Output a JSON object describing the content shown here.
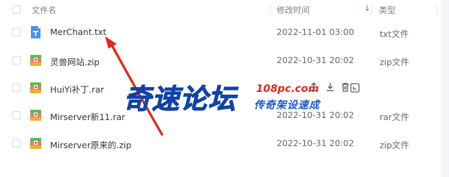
{
  "header": {
    "name_label": "文件名",
    "time_label": "修改时间",
    "sort_indicator": "↓",
    "type_label": "类型"
  },
  "files": [
    {
      "name": "MerChant.txt",
      "time": "2022-11-01 03:00",
      "type": "txt文件",
      "icon": "txt-file-icon"
    },
    {
      "name": "灵兽网站.zip",
      "time": "2022-10-31 20:02",
      "type": "zip文件",
      "icon": "archive-file-icon"
    },
    {
      "name": "HuiYi补丁.rar",
      "time": "",
      "type": "",
      "icon": "archive-file-icon"
    },
    {
      "name": "Mirserver新11.rar",
      "time": "2022-10-31 20:02",
      "type": "rar文件",
      "icon": "archive-file-icon"
    },
    {
      "name": "Mirserver原来的.zip",
      "time": "2022-10-31 20:02",
      "type": "zip文件",
      "icon": "archive-file-icon"
    }
  ],
  "watermark": {
    "main": "奇速论坛",
    "url": "108pc.com",
    "sub": "传奇架设速成"
  },
  "colors": {
    "accent": "#3a86ff",
    "arrow": "#e0281c",
    "watermark_blue": "#1a55c9"
  }
}
